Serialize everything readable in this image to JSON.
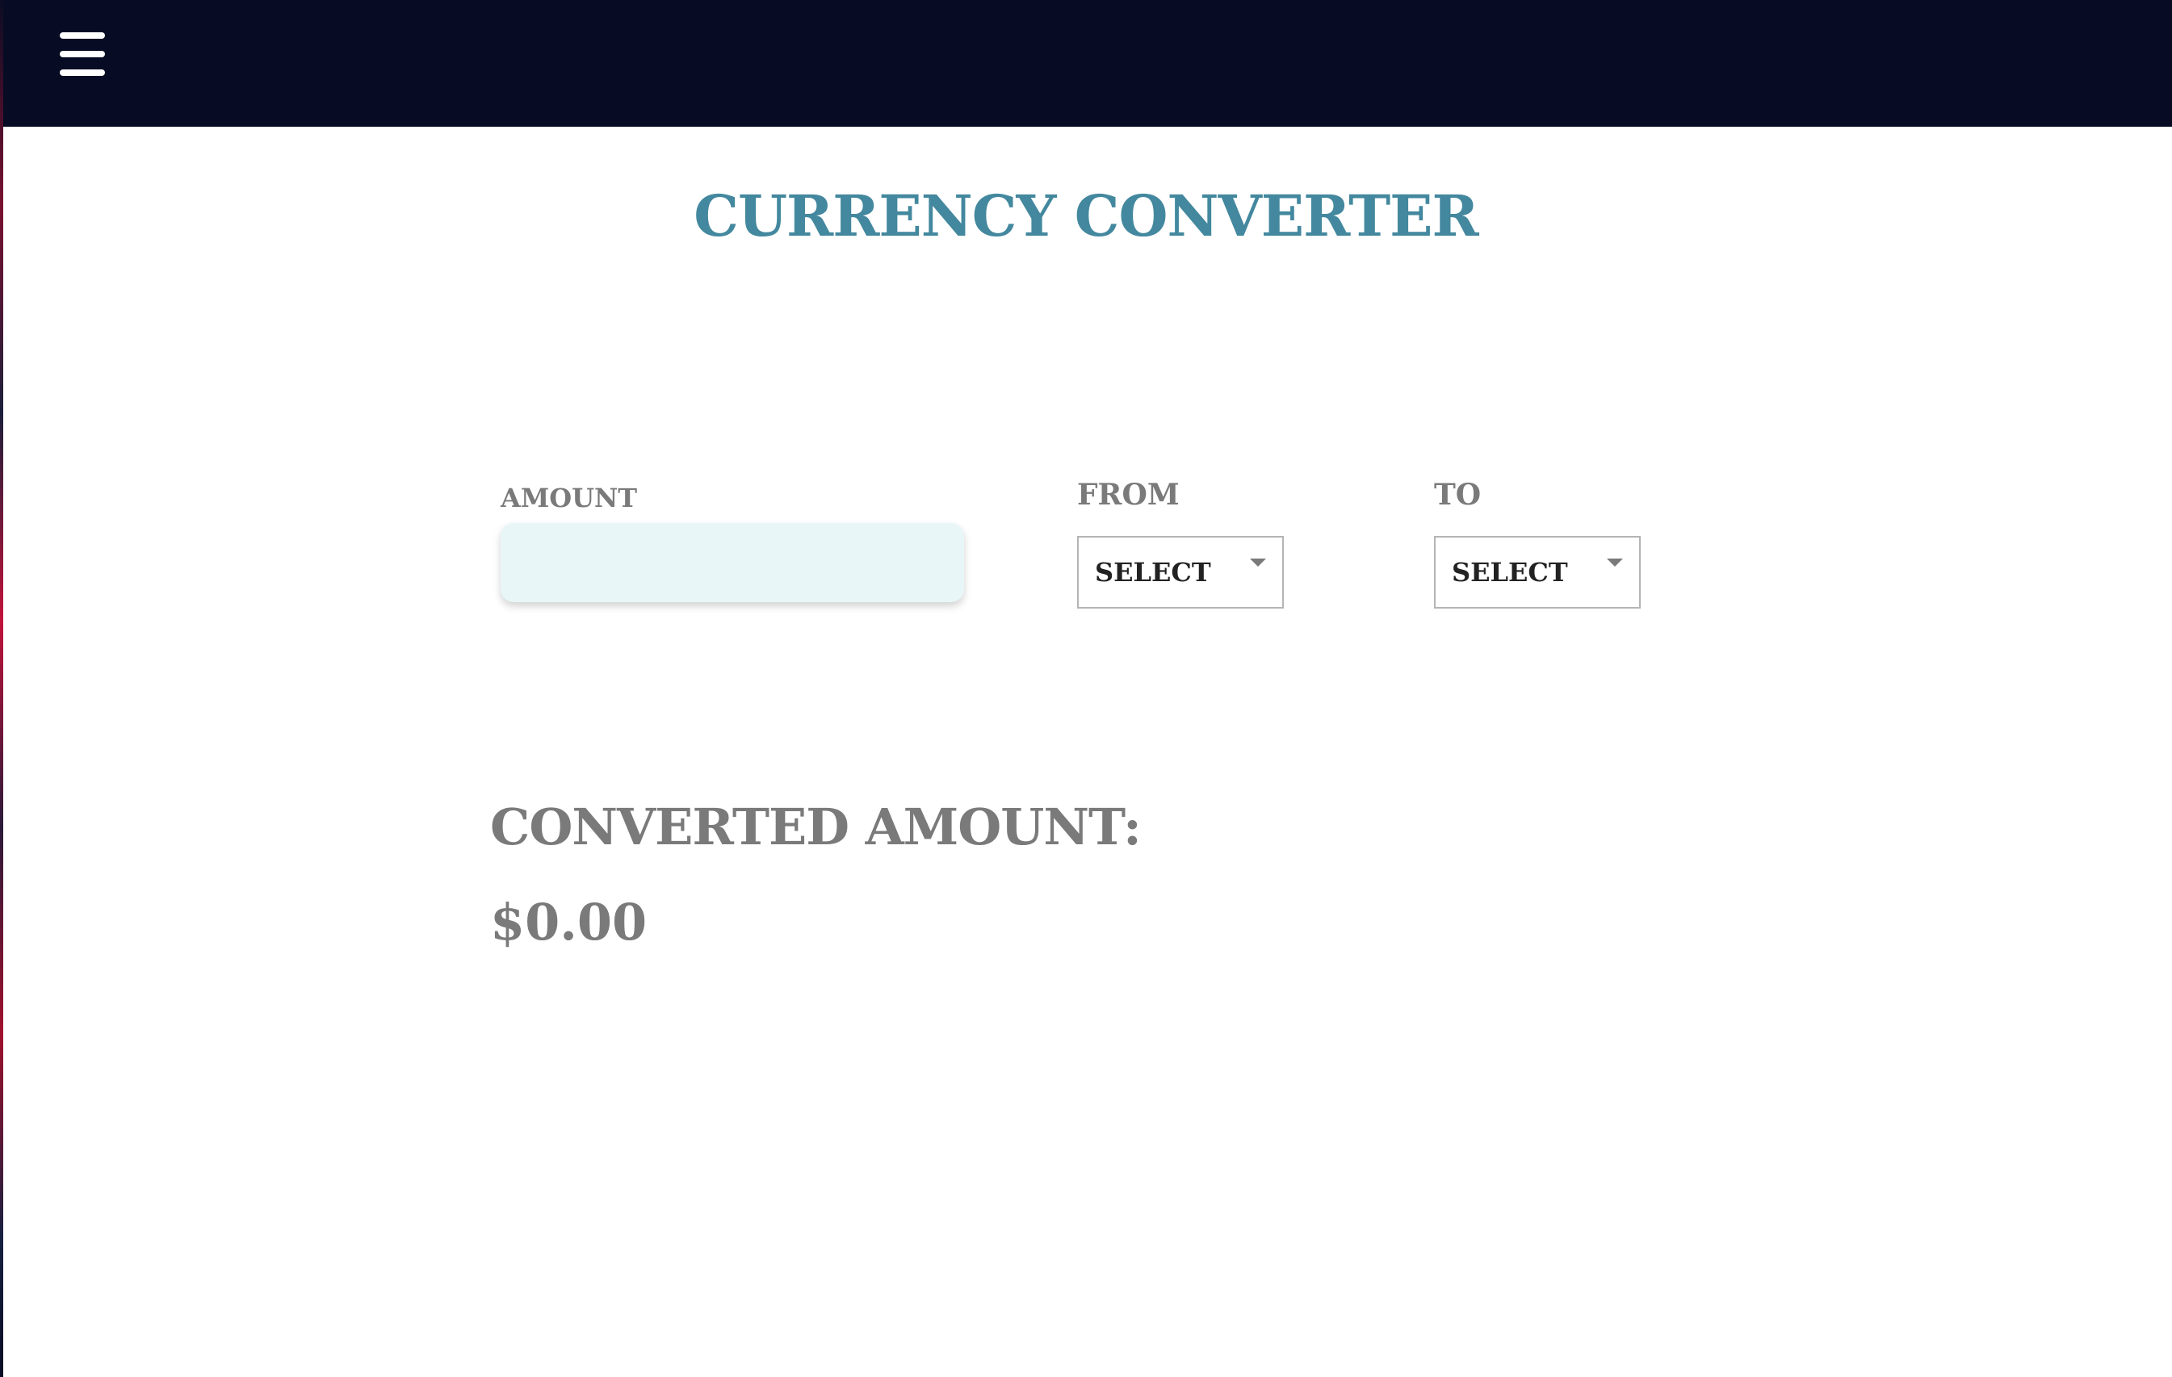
{
  "header": {
    "menu_icon": "hamburger-menu-icon",
    "background_color": "#070c24"
  },
  "page": {
    "title": "CURRENCY CONVERTER",
    "title_color": "#43889e"
  },
  "form": {
    "amount_label": "AMOUNT",
    "amount_value": "",
    "amount_placeholder": "",
    "from_label": "FROM",
    "from_selected": "SELECT",
    "to_label": "TO",
    "to_selected": "SELECT",
    "dropdown_icon": "caret-down-icon"
  },
  "result": {
    "label": "CONVERTED AMOUNT:",
    "value": "$0.00"
  }
}
